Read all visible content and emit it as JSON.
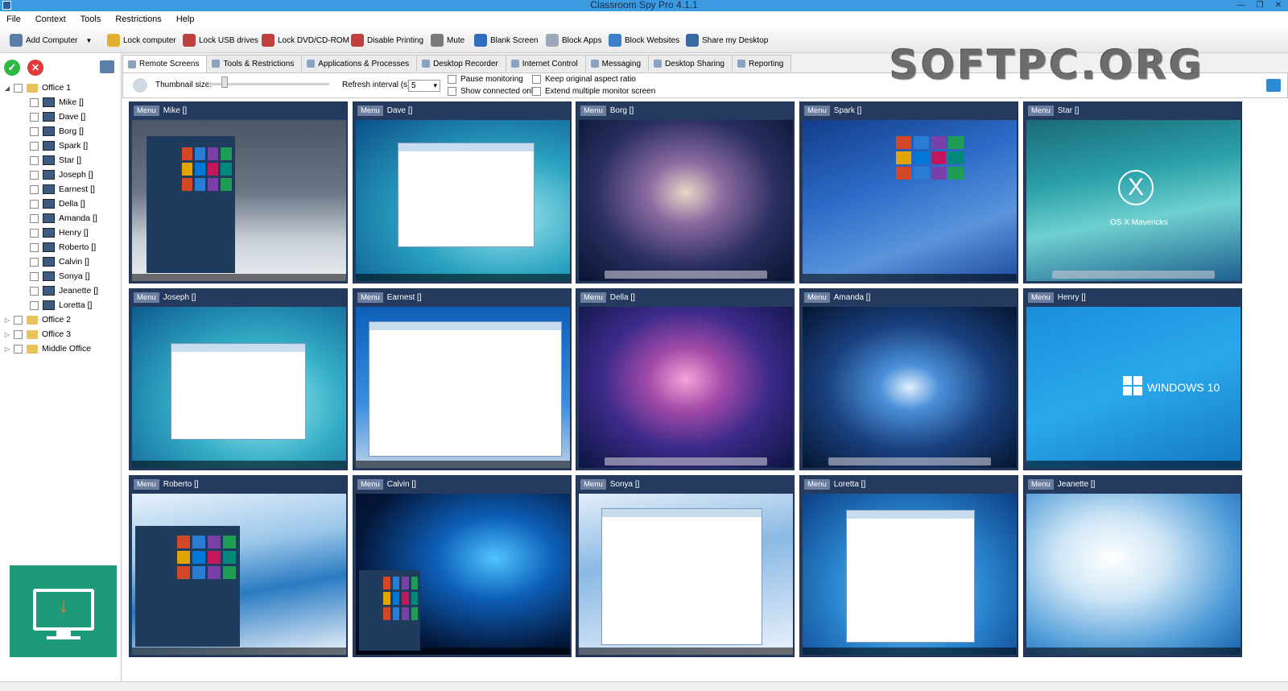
{
  "window": {
    "title": "Classroom Spy Pro 4.1.1"
  },
  "menu": [
    "File",
    "Context",
    "Tools",
    "Restrictions",
    "Help"
  ],
  "toolbar": [
    {
      "label": "Add Computer",
      "icon": "add-computer-icon",
      "color": "#5a7ea8"
    },
    {
      "label": "Lock computer",
      "icon": "lock-icon",
      "color": "#e0b030"
    },
    {
      "label": "Lock USB drives",
      "icon": "usb-icon",
      "color": "#c04040"
    },
    {
      "label": "Lock DVD/CD-ROM",
      "icon": "disc-icon",
      "color": "#c04040"
    },
    {
      "label": "Disable Printing",
      "icon": "printer-icon",
      "color": "#c04040"
    },
    {
      "label": "Mute",
      "icon": "speaker-icon",
      "color": "#7a7a7a"
    },
    {
      "label": "Blank Screen",
      "icon": "monitor-icon",
      "color": "#2f6fc0"
    },
    {
      "label": "Block Apps",
      "icon": "block-apps-icon",
      "color": "#9aa8b8"
    },
    {
      "label": "Block Websites",
      "icon": "globe-icon",
      "color": "#3f7fc8"
    },
    {
      "label": "Share my Desktop",
      "icon": "share-desktop-icon",
      "color": "#3a6aa0"
    }
  ],
  "tree": [
    {
      "label": "Office 1",
      "type": "folder",
      "expanded": true
    },
    {
      "label": "Mike []",
      "type": "computer"
    },
    {
      "label": "Dave []",
      "type": "computer"
    },
    {
      "label": "Borg []",
      "type": "computer"
    },
    {
      "label": "Spark []",
      "type": "computer"
    },
    {
      "label": "Star []",
      "type": "computer"
    },
    {
      "label": "Joseph []",
      "type": "computer"
    },
    {
      "label": "Earnest []",
      "type": "computer"
    },
    {
      "label": "Della []",
      "type": "computer"
    },
    {
      "label": "Amanda []",
      "type": "computer"
    },
    {
      "label": "Henry []",
      "type": "computer"
    },
    {
      "label": "Roberto []",
      "type": "computer"
    },
    {
      "label": "Calvin []",
      "type": "computer"
    },
    {
      "label": "Sonya []",
      "type": "computer"
    },
    {
      "label": "Jeanette []",
      "type": "computer"
    },
    {
      "label": "Loretta []",
      "type": "computer"
    },
    {
      "label": "Office 2",
      "type": "folder"
    },
    {
      "label": "Office 3",
      "type": "folder"
    },
    {
      "label": "Middle Office",
      "type": "folder"
    }
  ],
  "tabs": [
    "Remote Screens",
    "Tools & Restrictions",
    "Applications & Processes",
    "Desktop Recorder",
    "Internet Control",
    "Messaging",
    "Desktop Sharing",
    "Reporting"
  ],
  "options": {
    "thumbnail_size_label": "Thumbnail size:",
    "refresh_label": "Refresh interval (s):",
    "refresh_value": "5",
    "pause_monitoring": "Pause monitoring",
    "show_connected": "Show connected only",
    "keep_aspect": "Keep original aspect ratio",
    "extend_monitor": "Extend multiple monitor screen"
  },
  "watermark": "SOFTPC.ORG",
  "tiles": [
    {
      "menu": "Menu",
      "name": "Mike []",
      "desktop": "win10-dark"
    },
    {
      "menu": "Menu",
      "name": "Dave []",
      "desktop": "win7-window"
    },
    {
      "menu": "Menu",
      "name": "Borg []",
      "desktop": "mac-galaxy"
    },
    {
      "menu": "Menu",
      "name": "Spark []",
      "desktop": "win8-blue"
    },
    {
      "menu": "Menu",
      "name": "Star []",
      "desktop": "mac-mavericks",
      "caption": "OS X Mavericks"
    },
    {
      "menu": "Menu",
      "name": "Joseph []",
      "desktop": "win7-explorer"
    },
    {
      "menu": "Menu",
      "name": "Earnest []",
      "desktop": "win-explorer-big"
    },
    {
      "menu": "Menu",
      "name": "Della []",
      "desktop": "mac-pink"
    },
    {
      "menu": "Menu",
      "name": "Amanda []",
      "desktop": "mac-blue"
    },
    {
      "menu": "Menu",
      "name": "Henry []",
      "desktop": "win10-logo",
      "caption": "WINDOWS 10"
    },
    {
      "menu": "Menu",
      "name": "Roberto []",
      "desktop": "win10-start"
    },
    {
      "menu": "Menu",
      "name": "Calvin []",
      "desktop": "win10-hero"
    },
    {
      "menu": "Menu",
      "name": "Sonya []",
      "desktop": "win8-explorer"
    },
    {
      "menu": "Menu",
      "name": "Loretta []",
      "desktop": "win7-dialog"
    },
    {
      "menu": "Menu",
      "name": "Jeanette []",
      "desktop": "win8-daisy"
    }
  ]
}
